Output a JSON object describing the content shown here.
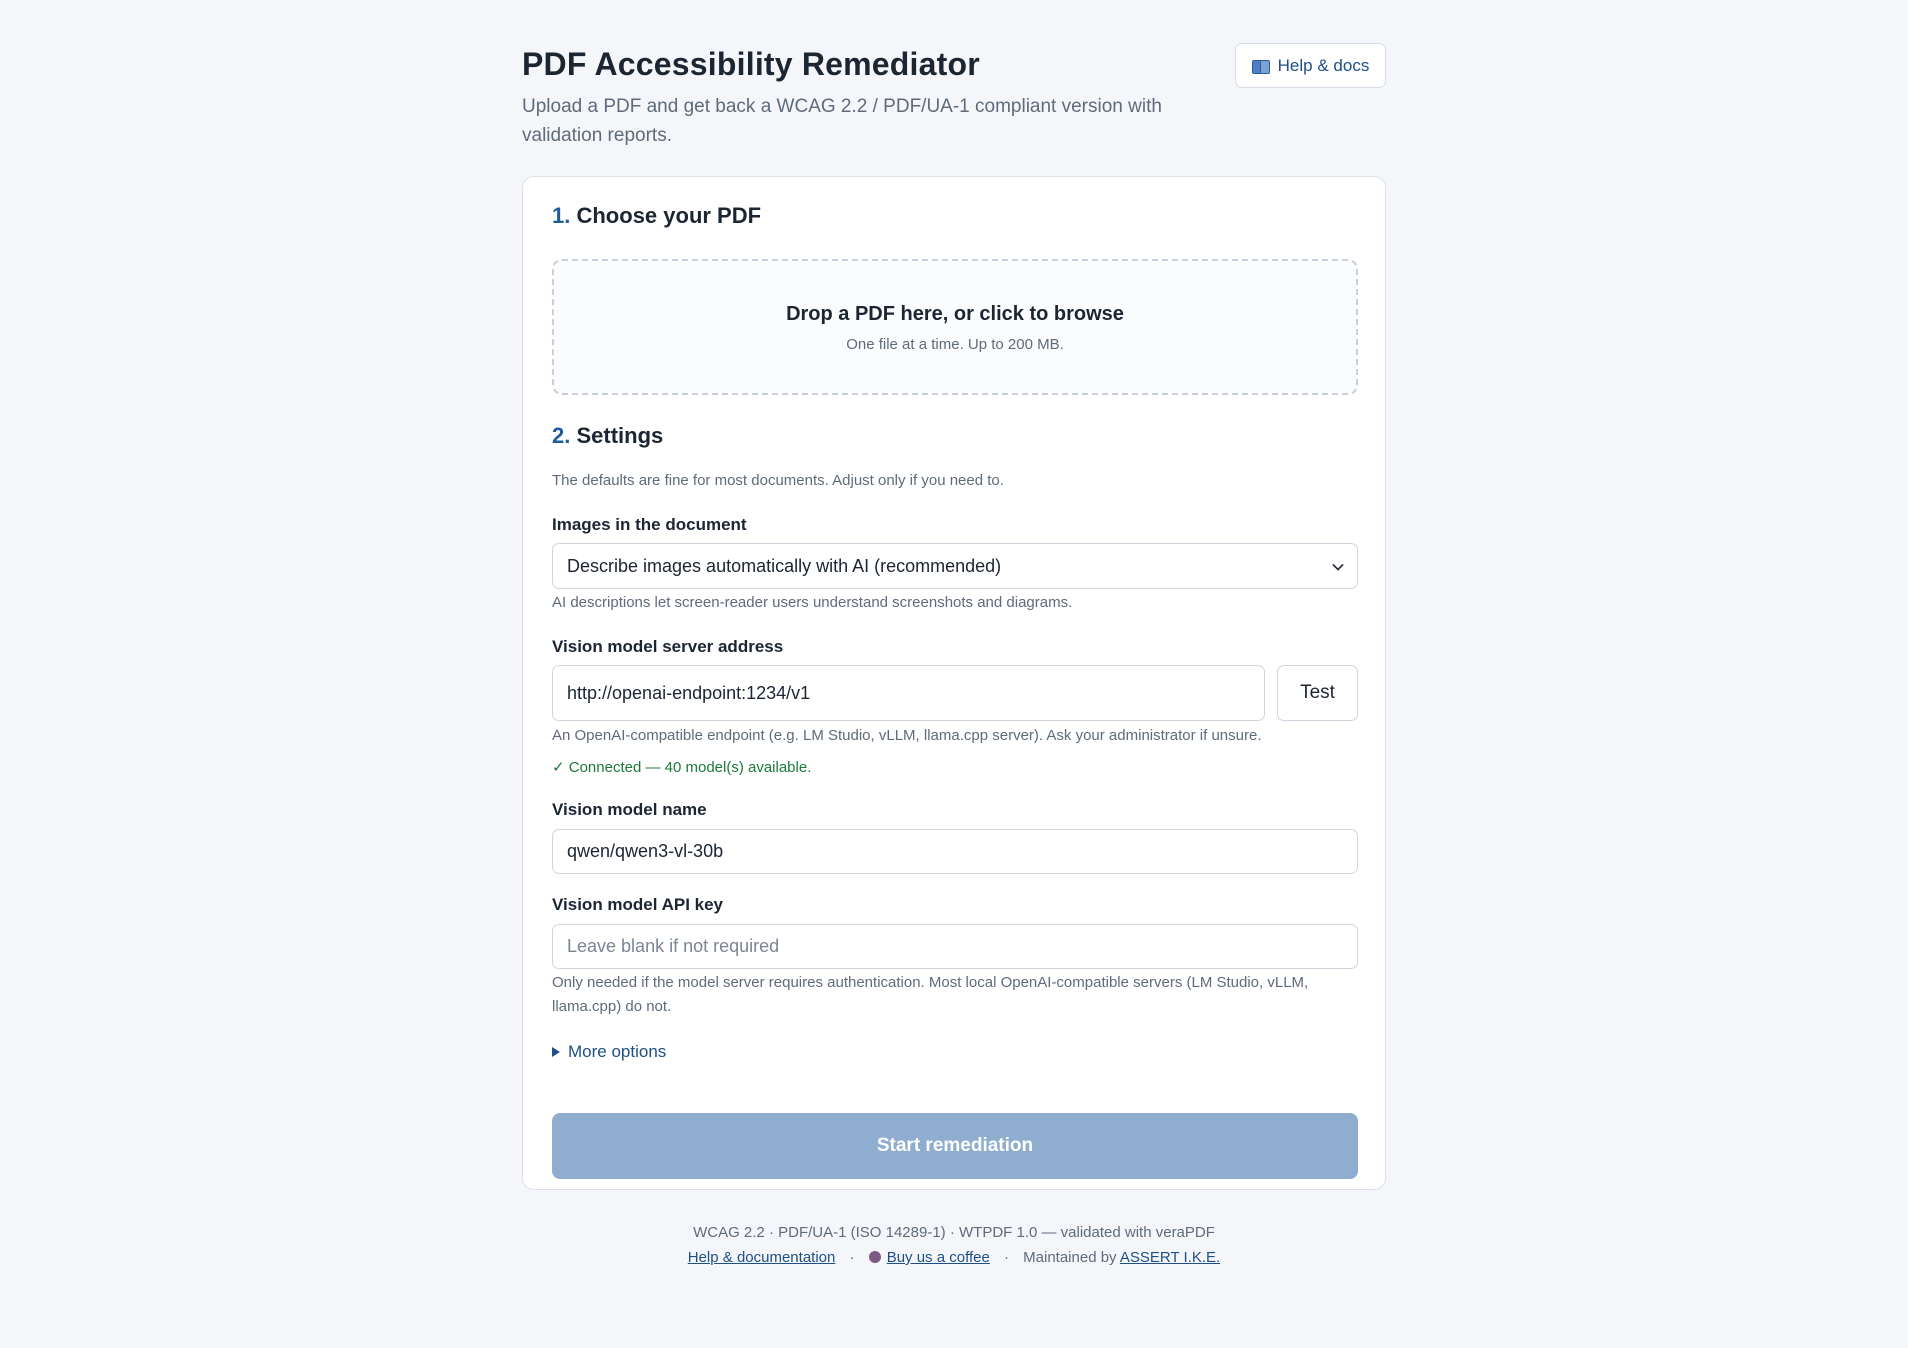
{
  "header": {
    "title": "PDF Accessibility Remediator",
    "subtitle": "Upload a PDF and get back a WCAG 2.2 / PDF/UA-1 compliant version with validation reports.",
    "help_label": "Help & docs"
  },
  "section1": {
    "num": "1.",
    "title": "Choose your PDF",
    "dropzone_main": "Drop a PDF here, or click to browse",
    "dropzone_sub": "One file at a time. Up to 200 MB."
  },
  "section2": {
    "num": "2.",
    "title": "Settings",
    "intro": "The defaults are fine for most documents. Adjust only if you need to.",
    "images_label": "Images in the document",
    "images_value": "Describe images automatically with AI (recommended)",
    "images_help": "AI descriptions let screen-reader users understand screenshots and diagrams.",
    "server_label": "Vision model server address",
    "server_value": "http://openai-endpoint:1234/v1",
    "test_label": "Test",
    "server_help": "An OpenAI-compatible endpoint (e.g. LM Studio, vLLM, llama.cpp server). Ask your administrator if unsure.",
    "connection_status": "✓ Connected — 40 model(s) available.",
    "model_label": "Vision model name",
    "model_value": "qwen/qwen3-vl-30b",
    "apikey_label": "Vision model API key",
    "apikey_placeholder": "Leave blank if not required",
    "apikey_help": "Only needed if the model server requires authentication. Most local OpenAI-compatible servers (LM Studio, vLLM, llama.cpp) do not.",
    "more_options": "More options",
    "start_label": "Start remediation"
  },
  "footer": {
    "standards": "WCAG 2.2 · PDF/UA-1 (ISO 14289-1) · WTPDF 1.0 — validated with veraPDF",
    "help_link": "Help & documentation",
    "coffee_link": "Buy us a coffee",
    "maintained_prefix": "Maintained by",
    "maintainer_link": "ASSERT I.K.E.",
    "separator": "·"
  },
  "colors": {
    "accent": "#1e5c9c",
    "success": "#1c7a39",
    "disabled_button": "#8eadcf"
  }
}
